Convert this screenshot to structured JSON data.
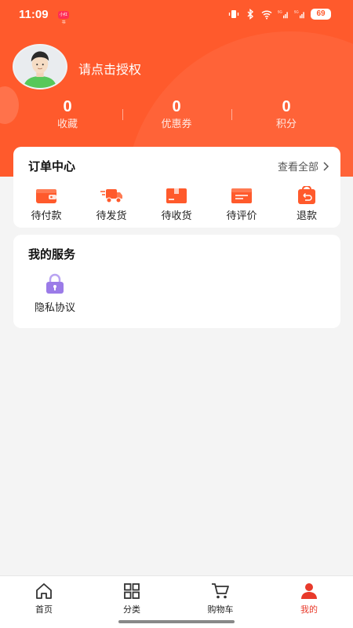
{
  "status_bar": {
    "time": "11:09",
    "app_badge": "小红书",
    "battery": "69",
    "network": "5G"
  },
  "profile": {
    "login_prompt": "请点击授权",
    "avatar_icon": "user-avatar-icon"
  },
  "stats": [
    {
      "value": "0",
      "label": "收藏"
    },
    {
      "value": "0",
      "label": "优惠券"
    },
    {
      "value": "0",
      "label": "积分"
    }
  ],
  "orders": {
    "title": "订单中心",
    "view_all": "查看全部",
    "items": [
      {
        "label": "待付款",
        "icon": "wallet-icon"
      },
      {
        "label": "待发货",
        "icon": "truck-icon"
      },
      {
        "label": "待收货",
        "icon": "package-icon"
      },
      {
        "label": "待评价",
        "icon": "review-icon"
      },
      {
        "label": "退款",
        "icon": "refund-icon"
      }
    ]
  },
  "services": {
    "title": "我的服务",
    "items": [
      {
        "label": "隐私协议",
        "icon": "lock-icon"
      }
    ]
  },
  "tabbar": {
    "items": [
      {
        "label": "首页",
        "icon": "home-icon",
        "active": false
      },
      {
        "label": "分类",
        "icon": "grid-icon",
        "active": false
      },
      {
        "label": "购物车",
        "icon": "cart-icon",
        "active": false
      },
      {
        "label": "我的",
        "icon": "person-icon",
        "active": true
      }
    ]
  },
  "colors": {
    "brand": "#ff5a2c",
    "active_tab": "#e83a2b",
    "service_icon": "#9b7be8"
  }
}
